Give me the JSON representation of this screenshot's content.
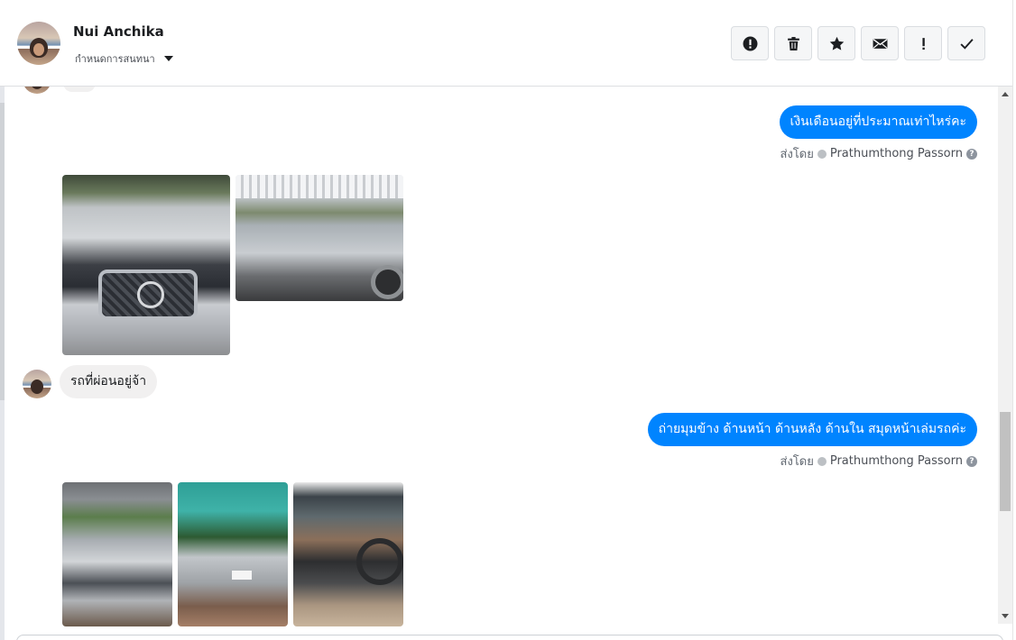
{
  "header": {
    "contact_name": "Nui Anchika",
    "assign_label": "กำหนดการสนทนา",
    "tools": [
      {
        "name": "report-icon"
      },
      {
        "name": "trash-icon"
      },
      {
        "name": "star-icon"
      },
      {
        "name": "mail-icon"
      },
      {
        "name": "exclamation-icon"
      },
      {
        "name": "check-icon"
      }
    ]
  },
  "messages": {
    "m1": {
      "text": "เงินเดือนอยู่ที่ประมาณเท่าไหร่คะ",
      "sent_by_prefix": "ส่งโดย",
      "sent_by": "Prathumthong Passorn"
    },
    "m2": {
      "text": "รถที่ผ่อนอยู่จ้า"
    },
    "m3": {
      "text": "ถ่ายมุมข้าง ด้านหน้า ด้านหลัง ด้านใน สมุดหน้าเล่มรถค่ะ",
      "sent_by_prefix": "ส่งโดย",
      "sent_by": "Prathumthong Passorn"
    }
  },
  "help_glyph": "?",
  "colors": {
    "accent": "#0084ff",
    "incoming_bubble": "#f1f0f0"
  }
}
